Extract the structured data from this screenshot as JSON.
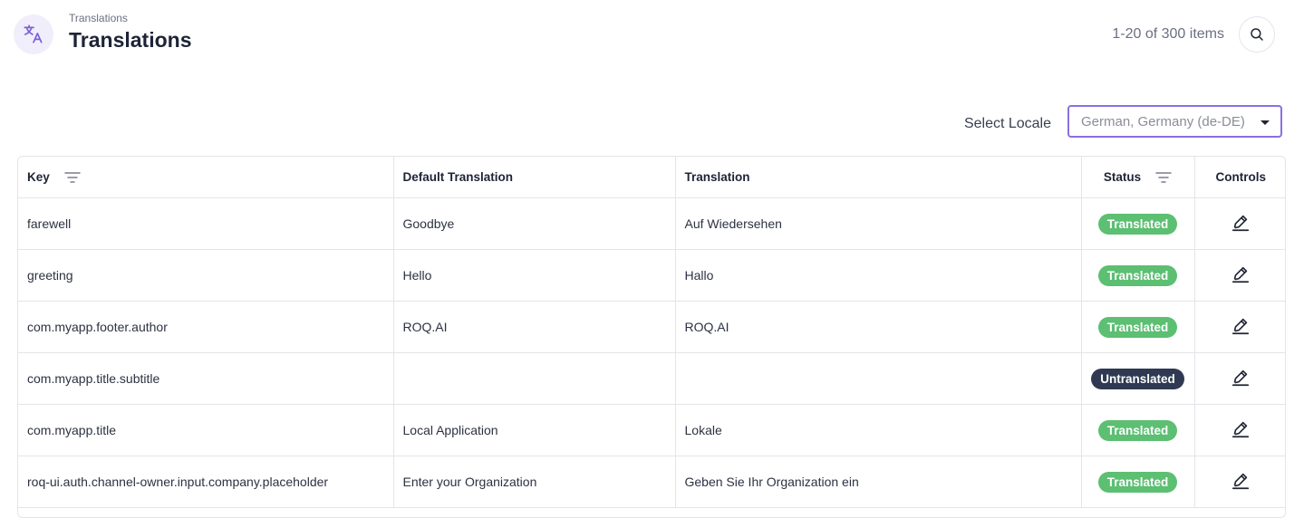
{
  "header": {
    "breadcrumb": "Translations",
    "title": "Translations",
    "item_count": "1-20 of 300 items"
  },
  "locale": {
    "label": "Select Locale",
    "selected": "German, Germany (de-DE)"
  },
  "table": {
    "columns": [
      "Key",
      "Default Translation",
      "Translation",
      "Status",
      "Controls"
    ],
    "rows": [
      {
        "key": "farewell",
        "default": "Goodbye",
        "translation": "Auf Wiedersehen",
        "status": "Translated"
      },
      {
        "key": "greeting",
        "default": "Hello",
        "translation": "Hallo",
        "status": "Translated"
      },
      {
        "key": "com.myapp.footer.author",
        "default": "ROQ.AI",
        "translation": "ROQ.AI",
        "status": "Translated"
      },
      {
        "key": "com.myapp.title.subtitle",
        "default": "",
        "translation": "",
        "status": "Untranslated"
      },
      {
        "key": "com.myapp.title",
        "default": "Local Application",
        "translation": "Lokale",
        "status": "Translated"
      },
      {
        "key": "roq-ui.auth.channel-owner.input.company.placeholder",
        "default": "Enter your Organization",
        "translation": "Geben Sie Ihr Organization ein",
        "status": "Translated"
      }
    ]
  },
  "colors": {
    "accent": "#8a6fe0",
    "translated": "#5cbf72",
    "untranslated": "#2f3a52"
  },
  "icons": {
    "logo": "translate-icon",
    "search": "search-icon",
    "filter": "filter-icon",
    "edit": "pencil-icon",
    "dropdown": "caret-down-icon"
  }
}
